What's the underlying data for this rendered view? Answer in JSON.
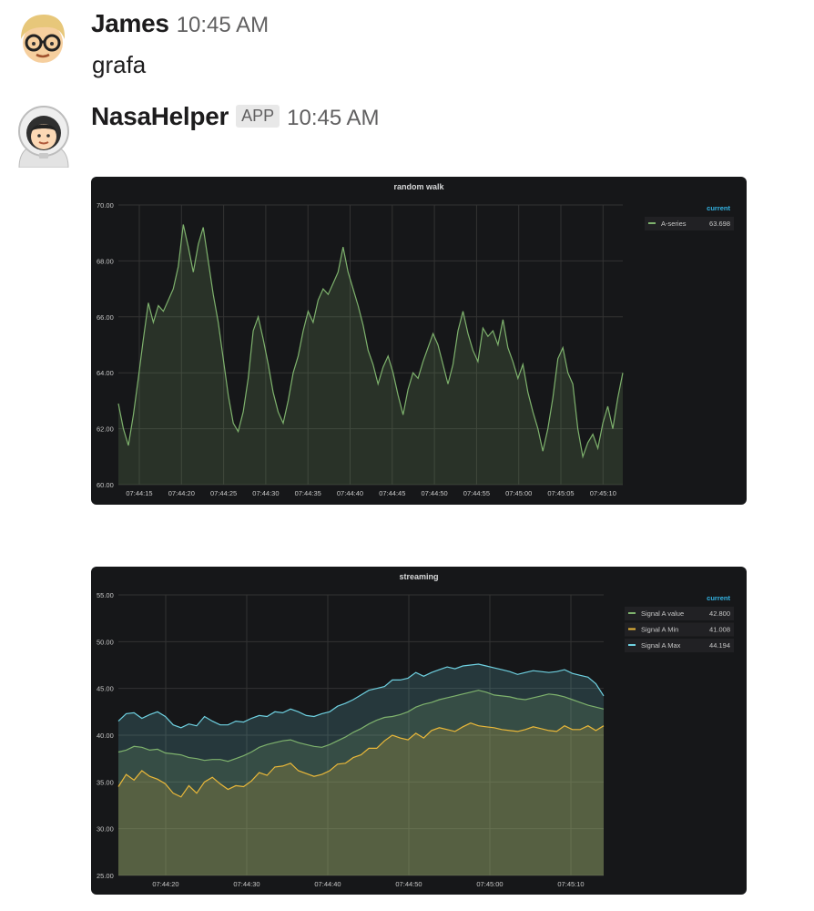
{
  "messages": [
    {
      "author": "James",
      "time": "10:45 AM",
      "text": "grafa"
    },
    {
      "author": "NasaHelper",
      "badge": "APP",
      "time": "10:45 AM"
    }
  ],
  "colors": {
    "panel_bg": "#161719",
    "grid": "#333333",
    "green": "#7eb26d",
    "yellow": "#eab839",
    "blue": "#6ed0e0",
    "legend_header": "#33b5e5",
    "text": "#d8d9da"
  },
  "chart_data": [
    {
      "type": "line",
      "title": "random walk",
      "ylim": [
        60,
        70
      ],
      "yticks": [
        "60.00",
        "62.00",
        "64.00",
        "66.00",
        "68.00",
        "70.00"
      ],
      "xticks": [
        "07:44:15",
        "07:44:20",
        "07:44:25",
        "07:44:30",
        "07:44:35",
        "07:44:40",
        "07:44:45",
        "07:44:50",
        "07:44:55",
        "07:45:00",
        "07:45:05",
        "07:45:10"
      ],
      "grid": true,
      "legend": {
        "placement": "right",
        "header": "current"
      },
      "series": [
        {
          "name": "A-series",
          "current": "63.698",
          "color": "#7eb26d",
          "values": [
            62.9,
            62.0,
            61.4,
            62.5,
            63.8,
            65.2,
            66.5,
            65.8,
            66.4,
            66.2,
            66.6,
            67.0,
            67.8,
            69.3,
            68.5,
            67.6,
            68.6,
            69.2,
            68.0,
            66.8,
            65.8,
            64.5,
            63.2,
            62.2,
            61.9,
            62.6,
            63.8,
            65.5,
            66.0,
            65.2,
            64.3,
            63.3,
            62.6,
            62.2,
            63.0,
            64.0,
            64.6,
            65.5,
            66.2,
            65.8,
            66.6,
            67.0,
            66.8,
            67.2,
            67.6,
            68.5,
            67.6,
            67.0,
            66.4,
            65.7,
            64.8,
            64.3,
            63.6,
            64.2,
            64.6,
            64.0,
            63.2,
            62.5,
            63.4,
            64.0,
            63.8,
            64.4,
            64.9,
            65.4,
            65.0,
            64.3,
            63.6,
            64.3,
            65.5,
            66.2,
            65.4,
            64.8,
            64.4,
            65.6,
            65.3,
            65.5,
            65.0,
            65.9,
            64.9,
            64.4,
            63.8,
            64.3,
            63.3,
            62.6,
            62.0,
            61.2,
            62.0,
            63.1,
            64.5,
            64.9,
            64.0,
            63.6,
            62.0,
            61.0,
            61.5,
            61.8,
            61.3,
            62.2,
            62.8,
            62.0,
            63.1,
            64.0
          ]
        }
      ]
    },
    {
      "type": "area",
      "title": "streaming",
      "ylim": [
        25,
        55
      ],
      "yticks": [
        "25.00",
        "30.00",
        "35.00",
        "40.00",
        "45.00",
        "50.00",
        "55.00"
      ],
      "xticks": [
        "07:44:20",
        "07:44:30",
        "07:44:40",
        "07:44:50",
        "07:45:00",
        "07:45:10"
      ],
      "grid": true,
      "legend": {
        "placement": "right",
        "header": "current"
      },
      "series": [
        {
          "name": "Signal A value",
          "current": "42.800",
          "color": "#7eb26d",
          "values": [
            38.2,
            38.4,
            38.8,
            38.7,
            38.4,
            38.5,
            38.1,
            38.0,
            37.9,
            37.6,
            37.5,
            37.3,
            37.4,
            37.4,
            37.2,
            37.5,
            37.8,
            38.2,
            38.7,
            39.0,
            39.2,
            39.4,
            39.5,
            39.2,
            39.0,
            38.8,
            38.7,
            39.0,
            39.4,
            39.8,
            40.3,
            40.7,
            41.2,
            41.6,
            41.9,
            42.0,
            42.2,
            42.5,
            43.0,
            43.3,
            43.5,
            43.8,
            44.0,
            44.2,
            44.4,
            44.6,
            44.8,
            44.6,
            44.3,
            44.2,
            44.1,
            43.9,
            43.8,
            44.0,
            44.2,
            44.4,
            44.3,
            44.1,
            43.8,
            43.5,
            43.2,
            43.0,
            42.8
          ]
        },
        {
          "name": "Signal A Min",
          "current": "41.008",
          "color": "#eab839",
          "values": [
            34.5,
            35.8,
            35.2,
            36.2,
            35.6,
            35.3,
            34.8,
            33.8,
            33.4,
            34.6,
            33.8,
            35.0,
            35.5,
            34.8,
            34.2,
            34.6,
            34.5,
            35.1,
            36.0,
            35.7,
            36.6,
            36.7,
            37.0,
            36.2,
            35.9,
            35.6,
            35.8,
            36.2,
            36.9,
            37.0,
            37.6,
            37.9,
            38.6,
            38.6,
            39.4,
            40.0,
            39.7,
            39.5,
            40.2,
            39.7,
            40.5,
            40.8,
            40.6,
            40.4,
            40.9,
            41.3,
            41.0,
            40.9,
            40.8,
            40.6,
            40.5,
            40.4,
            40.6,
            40.9,
            40.7,
            40.5,
            40.4,
            41.0,
            40.6,
            40.6,
            41.0,
            40.5,
            41.0
          ]
        },
        {
          "name": "Signal A Max",
          "current": "44.194",
          "color": "#6ed0e0",
          "values": [
            41.5,
            42.3,
            42.4,
            41.8,
            42.2,
            42.5,
            42.0,
            41.1,
            40.8,
            41.2,
            41.0,
            42.0,
            41.5,
            41.1,
            41.1,
            41.5,
            41.4,
            41.8,
            42.1,
            42.0,
            42.5,
            42.4,
            42.8,
            42.5,
            42.1,
            42.0,
            42.3,
            42.5,
            43.1,
            43.4,
            43.8,
            44.3,
            44.8,
            45.0,
            45.2,
            45.9,
            45.9,
            46.1,
            46.7,
            46.3,
            46.7,
            47.0,
            47.3,
            47.1,
            47.4,
            47.5,
            47.6,
            47.4,
            47.2,
            47.0,
            46.8,
            46.5,
            46.7,
            46.9,
            46.8,
            46.7,
            46.8,
            47.0,
            46.6,
            46.4,
            46.2,
            45.5,
            44.2
          ]
        }
      ]
    }
  ]
}
